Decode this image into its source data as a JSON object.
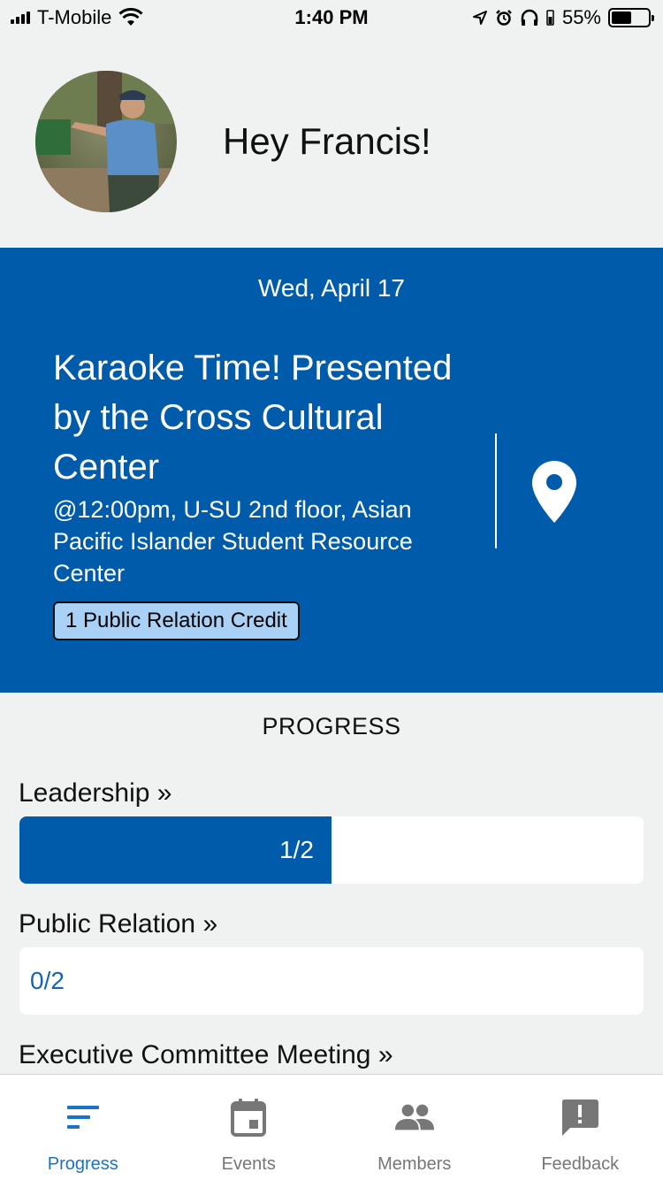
{
  "status_bar": {
    "carrier": "T-Mobile",
    "time": "1:40 PM",
    "battery": "55%",
    "battery_level": 0.55
  },
  "header": {
    "greeting": "Hey Francis!"
  },
  "event": {
    "date": "Wed, April 17",
    "title": "Karaoke Time! Presented by the Cross Cultural Center",
    "details": "@12:00pm, U-SU 2nd floor, Asian Pacific Islander Student Resource Center",
    "credit": "1 Public Relation Credit"
  },
  "progress": {
    "heading": "PROGRESS",
    "categories": [
      {
        "label": "Leadership »",
        "value_text": "1/2",
        "fraction": 0.5
      },
      {
        "label": "Public Relation »",
        "value_text": "0/2",
        "fraction": 0
      },
      {
        "label": "Executive Committee Meeting »"
      }
    ]
  },
  "tabs": [
    {
      "label": "Progress",
      "icon": "progress-icon",
      "active": true
    },
    {
      "label": "Events",
      "icon": "calendar-icon",
      "active": false
    },
    {
      "label": "Members",
      "icon": "members-icon",
      "active": false
    },
    {
      "label": "Feedback",
      "icon": "feedback-icon",
      "active": false
    }
  ],
  "colors": {
    "primary": "#005cab",
    "badge": "#a8d1f5",
    "active_tab": "#1a73c8"
  }
}
